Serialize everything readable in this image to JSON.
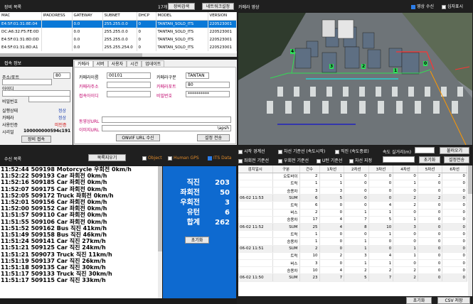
{
  "device_panel": {
    "title": "장비 목록",
    "count": "17개",
    "search_btn": "장비검색",
    "net_btn": "네트워크설정",
    "columns": [
      "MAC",
      "IPADDRESS",
      "GATEWAY",
      "SUBNET",
      "DHCP",
      "MODEL",
      "VERSION"
    ],
    "rows": [
      [
        "E4:5F:01:31:8E:04",
        "",
        "0.0",
        "255.255.0.0",
        "0",
        "TANTAN_SOLO_ITS",
        "220523001"
      ],
      [
        "DC:A6:32:F5:FE:0D",
        "",
        "0.0",
        "255.255.0.0",
        "0",
        "TANTAN_SOLO_ITS",
        "220523001"
      ],
      [
        "E4:5F:01:31:8D:DD",
        "",
        "0.0",
        "255.255.0.0",
        "0",
        "TANTAN_SOLO_ITS",
        "220523001"
      ],
      [
        "E4:5F:01:31:8D:A1",
        "",
        "0.0",
        "255.255.254.0",
        "0",
        "TANTAN_SOLO_ITS",
        "220523001"
      ]
    ]
  },
  "camera_video": {
    "title": "카메라 영상",
    "video_recv": "영상 수신",
    "crosshair": "십자표시",
    "lane_labels": [
      "4",
      "3",
      "2",
      "1",
      "0"
    ]
  },
  "connection": {
    "title": "접속 정보",
    "addr_port_label": "주소/포트",
    "port": "80",
    "id_label": "아이디",
    "pw_label": "비밀번호",
    "run_state_label": "실행상태",
    "run_state": "정상",
    "camera_label": "카메라",
    "camera_state": "정상",
    "auth_label": "사용인증",
    "auth_state": "미인증",
    "serial_label": "시리얼",
    "serial": "100000000594c191",
    "connect_btn": "장비 접속"
  },
  "camera_tabs": {
    "tabs": [
      "카메라",
      "서버",
      "사용자",
      "시간",
      "업데이트"
    ],
    "cam_label": "카메라이름",
    "cam_name": "00101",
    "cam_type_label": "카메라구분",
    "cam_type": "TANTAN",
    "cam_addr_label": "카메라주소",
    "cam_port_label": "카메라포트",
    "cam_port": "80",
    "conn_id_label": "접속아이디",
    "conn_pw_label": "비밀번호",
    "conn_pw": "**********",
    "video_url_label": "동영상URL",
    "image_url_label": "이미지URL",
    "image_url_tail": "\\apsh",
    "onvif_btn": "ONVIF URL 수신",
    "save_btn": "설정 전송"
  },
  "receive": {
    "title": "수신 목록",
    "clear_btn": "목록지우기",
    "object_opt": "Object",
    "gps_opt": "Human GPS",
    "its_opt": "ITS Data",
    "log": [
      "11:52:44 509198 Motorcycle 우회전 0km/h",
      "11:52:22 509193 Car 좌회전 0km/h",
      "11:52:16 509185 Car 좌회전 0km/h",
      "11:52:07 509175 Car 좌회전 0km/h",
      "11:52:05 509172 Truck 좌회전 0km/h",
      "11:52:01 509156 Car 좌회전 0km/h",
      "11:52:00 509152 Car 좌회전 0km/h",
      "11:51:57 509110 Car 좌회전 0km/h",
      "11:51:55 509106 Car 좌회전 0km/h",
      "11:51:52 509162 Bus 직진 41km/h",
      "11:51:49 509158 Bus 직진 46km/h",
      "11:51:24 509141 Car 직진 27km/h",
      "11:51:21 509125 Car 직진 24km/h",
      "11:51:21 509073 Truck 직진 11km/h",
      "11:51:19 509137 Car 직진 26km/h",
      "11:51:18 509135 Car 직진 30km/h",
      "11:51:17 509133 Truck 직진 30km/h",
      "11:51:17 509115 Car 직진 33km/h"
    ]
  },
  "summary": {
    "rows": [
      {
        "label": "직진",
        "value": "203"
      },
      {
        "label": "좌회전",
        "value": "50"
      },
      {
        "label": "우회전",
        "value": "3"
      },
      {
        "label": "유턴",
        "value": "6"
      },
      {
        "label": "합계",
        "value": "262"
      }
    ],
    "reset_btn": "초기화"
  },
  "options": {
    "items": [
      {
        "label": "시작 경계선",
        "on": false
      },
      {
        "label": "차선 기준선 (속도시작)",
        "on": false
      },
      {
        "label": "직진 (속도종료)",
        "on": false
      },
      {
        "label": "좌회전 기준선",
        "on": false
      },
      {
        "label": "우회전 기준선",
        "on": false
      },
      {
        "label": "U턴 기준선",
        "on": false
      },
      {
        "label": "차선 지정",
        "on": false
      }
    ],
    "speed_label": "속도 실거리(m)",
    "speed_value": "10",
    "load_btn": "불러오기",
    "combo": "",
    "reset_btn": "초기화",
    "apply_btn": "설정전송"
  },
  "stats": {
    "columns": [
      "검지일시",
      "구분",
      "건수",
      "1차선",
      "2차선",
      "3차선",
      "4차선",
      "5차선",
      "6차선"
    ],
    "rows": [
      [
        "",
        "오토바이",
        "2",
        "1",
        "0",
        "0",
        "0",
        "2",
        "0"
      ],
      [
        "",
        "트럭",
        "1",
        "1",
        "0",
        "0",
        "1",
        "0",
        "0"
      ],
      [
        "",
        "승용차",
        "3",
        "3",
        "0",
        "0",
        "0",
        "0",
        "0"
      ],
      [
        "06-02 11:53",
        "SUM",
        "6",
        "5",
        "0",
        "0",
        "2",
        "2",
        "0"
      ],
      [
        "",
        "트럭",
        "6",
        "0",
        "0",
        "4",
        "2",
        "0",
        "0"
      ],
      [
        "",
        "버스",
        "2",
        "0",
        "1",
        "1",
        "0",
        "0",
        "0"
      ],
      [
        "",
        "승용차",
        "17",
        "4",
        "7",
        "5",
        "1",
        "0",
        "0"
      ],
      [
        "06-02 11:52",
        "SUM",
        "25",
        "4",
        "8",
        "10",
        "3",
        "0",
        "0"
      ],
      [
        "",
        "트럭",
        "1",
        "0",
        "0",
        "1",
        "0",
        "0",
        "0"
      ],
      [
        "",
        "승용차",
        "1",
        "0",
        "1",
        "0",
        "0",
        "0",
        "0"
      ],
      [
        "06-02 11:51",
        "SUM",
        "2",
        "0",
        "1",
        "0",
        "1",
        "0",
        "0"
      ],
      [
        "",
        "트럭",
        "10",
        "2",
        "3",
        "4",
        "1",
        "0",
        "0"
      ],
      [
        "",
        "버스",
        "3",
        "0",
        "1",
        "1",
        "0",
        "0",
        "0"
      ],
      [
        "",
        "승용차",
        "10",
        "4",
        "2",
        "2",
        "2",
        "0",
        "0"
      ],
      [
        "06-02 11:50",
        "SUM",
        "23",
        "7",
        "5",
        "7",
        "2",
        "0",
        "0"
      ]
    ],
    "reset_btn": "초기화",
    "csv_btn": "CSV 저장"
  }
}
